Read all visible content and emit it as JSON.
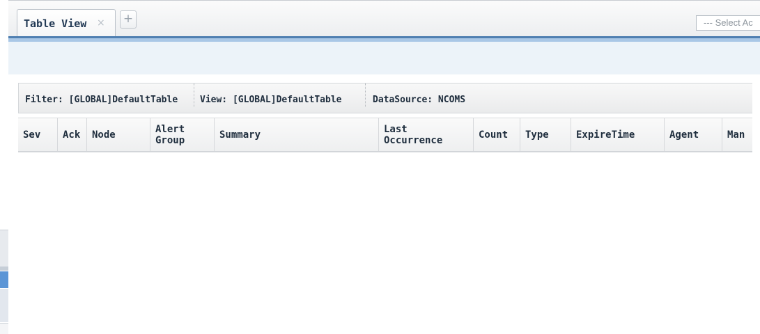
{
  "tabs": {
    "active_label": "Table View",
    "close_glyph": "×",
    "add_glyph": "+"
  },
  "action_select": {
    "value": "--- Select Ac"
  },
  "filter_bar": {
    "filter": "Filter: [GLOBAL]DefaultTable",
    "view": "View: [GLOBAL]DefaultTable",
    "datasource": "DataSource: NCOMS"
  },
  "table": {
    "columns": [
      {
        "label": "Sev"
      },
      {
        "label": "Ack"
      },
      {
        "label": "Node"
      },
      {
        "label": "Alert\nGroup"
      },
      {
        "label": "Summary"
      },
      {
        "label": "Last\nOccurrence"
      },
      {
        "label": "Count"
      },
      {
        "label": "Type"
      },
      {
        "label": "ExpireTime"
      },
      {
        "label": "Agent"
      },
      {
        "label": "Man"
      }
    ],
    "rows": []
  },
  "colors": {
    "accent": "#4f7fb1",
    "header_text": "#1e2d3d",
    "tab_text": "#233a55"
  }
}
